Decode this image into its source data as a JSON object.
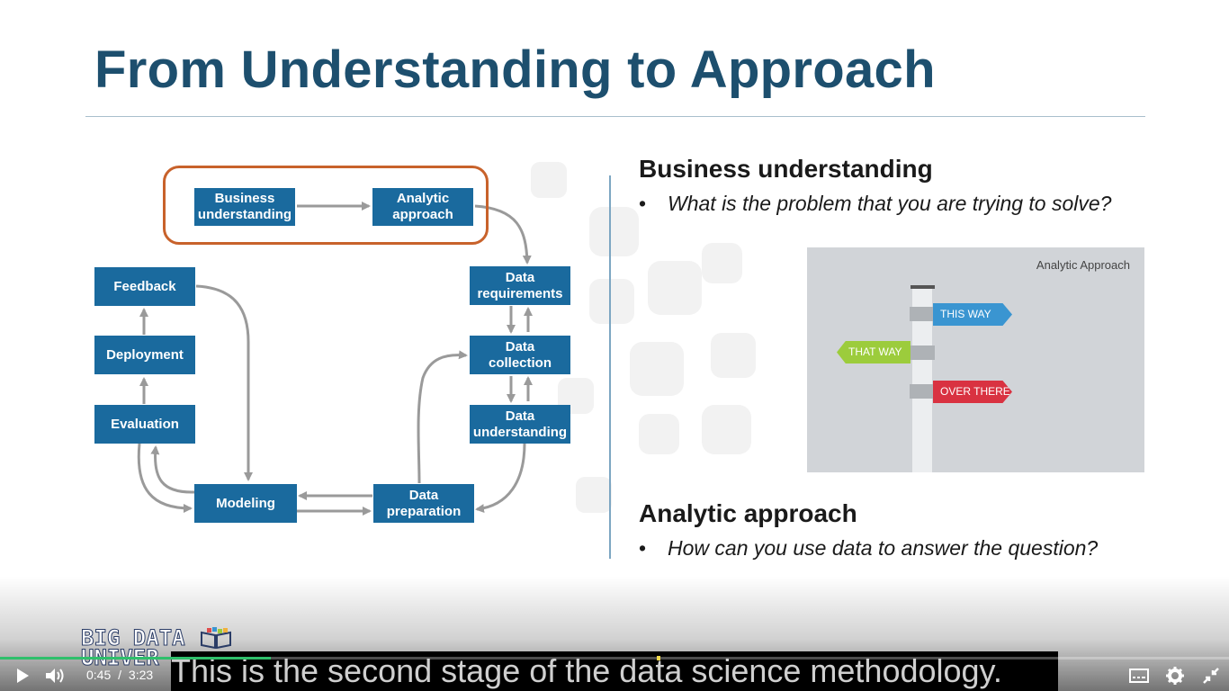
{
  "slide": {
    "title": "From Understanding to Approach"
  },
  "diagram": {
    "stages": {
      "business_understanding": "Business\nunderstanding",
      "analytic_approach": "Analytic\napproach",
      "data_requirements": "Data\nrequirements",
      "data_collection": "Data\ncollection",
      "data_understanding": "Data\nunderstanding",
      "data_preparation": "Data\npreparation",
      "modeling": "Modeling",
      "evaluation": "Evaluation",
      "deployment": "Deployment",
      "feedback": "Feedback"
    },
    "colors": {
      "stage_fill": "#1a6a9e",
      "highlight": "#c8622b",
      "arrow": "#9a9a9a"
    }
  },
  "content": {
    "section1": {
      "heading": "Business understanding",
      "bullet": "What is the problem that you are trying to solve?"
    },
    "section2": {
      "heading": "Analytic approach",
      "bullet": "How can you use data to answer the question?"
    },
    "bullet_symbol": "•",
    "signpost_image": {
      "label": "Analytic Approach",
      "signs": [
        {
          "text": "THIS WAY",
          "color": "#3a95d1"
        },
        {
          "text": "THAT WAY",
          "color": "#9ccc3c"
        },
        {
          "text": "OVER THERE",
          "color": "#d93241"
        }
      ]
    }
  },
  "player": {
    "brand_line1": "BIG DATA",
    "brand_line2": "UNIVER",
    "caption": "This is the second stage of the data science methodology.",
    "time_current": "0:45",
    "time_separator": "/",
    "time_total": "3:23",
    "progress": 0.22,
    "icons": {
      "play": "play-icon",
      "volume": "volume-icon",
      "captions": "captions-icon",
      "settings": "gear-icon",
      "fullscreen": "exit-fullscreen-icon"
    },
    "colors": {
      "progress": "#2fbf6b"
    }
  }
}
